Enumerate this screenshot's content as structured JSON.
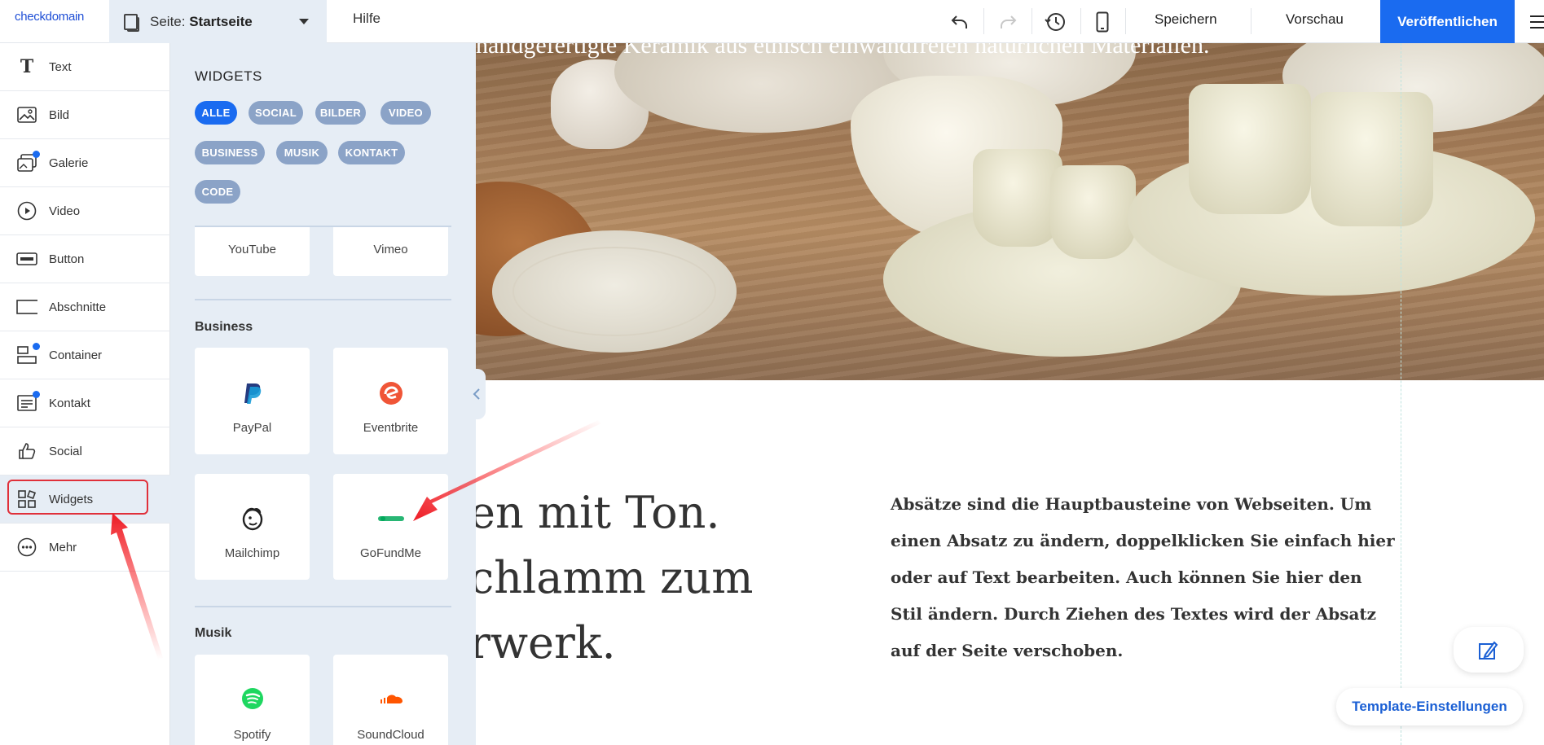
{
  "app": {
    "logo": "checkdomain"
  },
  "topbar": {
    "page_prefix": "Seite: ",
    "page_name": "Startseite",
    "help": "Hilfe",
    "save": "Speichern",
    "preview": "Vorschau",
    "publish": "Veröffentlichen",
    "icons": [
      "undo-icon",
      "redo-icon",
      "history-icon",
      "mobile-preview-icon",
      "menu-icon"
    ]
  },
  "leftbar": {
    "items": [
      {
        "label": "Text",
        "icon": "text-icon",
        "badge": false
      },
      {
        "label": "Bild",
        "icon": "image-icon",
        "badge": false
      },
      {
        "label": "Galerie",
        "icon": "gallery-icon",
        "badge": true
      },
      {
        "label": "Video",
        "icon": "video-icon",
        "badge": false
      },
      {
        "label": "Button",
        "icon": "button-icon",
        "badge": false
      },
      {
        "label": "Abschnitte",
        "icon": "section-icon",
        "badge": false
      },
      {
        "label": "Container",
        "icon": "container-icon",
        "badge": true
      },
      {
        "label": "Kontakt",
        "icon": "contact-icon",
        "badge": true
      },
      {
        "label": "Social",
        "icon": "thumbs-up-icon",
        "badge": false
      },
      {
        "label": "Widgets",
        "icon": "widgets-icon",
        "badge": false
      },
      {
        "label": "Mehr",
        "icon": "more-icon",
        "badge": false
      }
    ],
    "highlighted": "Widgets"
  },
  "widgets_panel": {
    "title": "WIDGETS",
    "filters": [
      "ALLE",
      "SOCIAL",
      "BILDER",
      "VIDEO",
      "BUSINESS",
      "MUSIK",
      "KONTAKT",
      "CODE"
    ],
    "active_filter": "ALLE",
    "video_items": [
      "YouTube",
      "Vimeo"
    ],
    "sections": [
      {
        "title": "Business",
        "items": [
          "PayPal",
          "Eventbrite",
          "Mailchimp",
          "GoFundMe"
        ]
      },
      {
        "title": "Musik",
        "items": [
          "Spotify",
          "SoundCloud"
        ]
      }
    ]
  },
  "canvas": {
    "hero_caption": "handgefertigte Keramik aus ethisch einwandfreien natürlichen Materialien.",
    "heading_lines": [
      "en mit Ton.",
      "chlamm zum",
      "rwerk."
    ],
    "paragraph": "Absätze sind die Hauptbausteine von Webseiten. Um einen Absatz zu ändern, doppelklicken Sie einfach hier oder auf Text bearbeiten. Auch können Sie hier den Stil ändern. Durch Ziehen des Textes wird der Absatz auf der Seite verschoben.",
    "template_settings": "Template-Einstellungen",
    "design_icon": "design-edit-icon"
  },
  "colors": {
    "accent": "#1a6bf0",
    "panel_bg": "#e6edf5",
    "chip_inactive": "#8ba3c7",
    "highlight_red": "#e0303a"
  }
}
